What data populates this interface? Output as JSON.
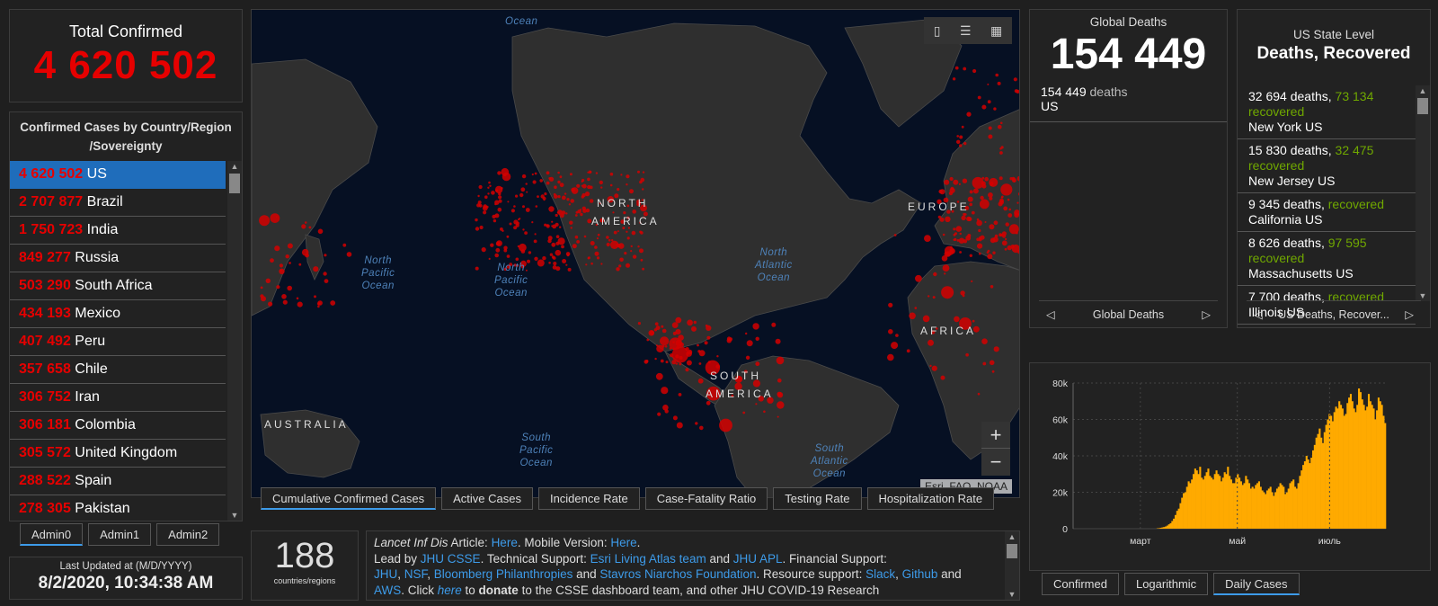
{
  "total": {
    "label": "Total Confirmed",
    "value": "4 620 502"
  },
  "countries": {
    "header": "Confirmed Cases by Country/Region/Sovereignty",
    "items": [
      {
        "num": "4 620 502",
        "name": "US"
      },
      {
        "num": "2 707 877",
        "name": "Brazil"
      },
      {
        "num": "1 750 723",
        "name": "India"
      },
      {
        "num": "849 277",
        "name": "Russia"
      },
      {
        "num": "503 290",
        "name": "South Africa"
      },
      {
        "num": "434 193",
        "name": "Mexico"
      },
      {
        "num": "407 492",
        "name": "Peru"
      },
      {
        "num": "357 658",
        "name": "Chile"
      },
      {
        "num": "306 752",
        "name": "Iran"
      },
      {
        "num": "306 181",
        "name": "Colombia"
      },
      {
        "num": "305 572",
        "name": "United Kingdom"
      },
      {
        "num": "288 522",
        "name": "Spain"
      },
      {
        "num": "278 305",
        "name": "Pakistan"
      }
    ]
  },
  "admin_tabs": [
    "Admin0",
    "Admin1",
    "Admin2"
  ],
  "updated": {
    "label": "Last Updated at (M/D/YYYY)",
    "value": "8/2/2020, 10:34:38 AM"
  },
  "map": {
    "labels": {
      "north_america_1": "NORTH",
      "north_america_2": "AMERICA",
      "south_america_1": "SOUTH",
      "south_america_2": "AMERICA",
      "europe": "EUROPE",
      "africa": "AFRICA",
      "australia": "AUSTRALIA",
      "np1_a": "North",
      "np1_b": "Pacific",
      "np1_c": "Ocean",
      "np2_a": "North",
      "np2_b": "Pacific",
      "np2_c": "Ocean",
      "na_a": "North",
      "na_b": "Atlantic",
      "na_c": "Ocean",
      "sp_a": "South",
      "sp_b": "Pacific",
      "sp_c": "Ocean",
      "sa_a": "South",
      "sa_b": "Atlantic",
      "sa_c": "Ocean",
      "arctic": "Ocean"
    },
    "attribution": "Esri, FAO, NOAA",
    "zoom_in": "+",
    "zoom_out": "−"
  },
  "map_tabs": [
    "Cumulative Confirmed Cases",
    "Active Cases",
    "Incidence Rate",
    "Case-Fatality Ratio",
    "Testing Rate",
    "Hospitalization Rate"
  ],
  "counter": {
    "value": "188",
    "label": "countries/regions"
  },
  "info": {
    "a1": "Lancet Inf Dis",
    "a2": " Article: ",
    "a3": "Here",
    "a4": ". Mobile Version: ",
    "a5": "Here",
    "a6": ".",
    "b1": "Lead by ",
    "b2": "JHU CSSE",
    "b3": ". Technical Support: ",
    "b4": "Esri Living Atlas team",
    "b5": " and ",
    "b6": "JHU APL",
    "b7": ". Financial Support:",
    "c1": "JHU",
    "c2": ", ",
    "c3": "NSF",
    "c4": ", ",
    "c5": "Bloomberg Philanthropies",
    "c6": " and ",
    "c7": "Stavros Niarchos Foundation",
    "c8": ". Resource support: ",
    "c9": "Slack",
    "c10": ", ",
    "c11": "Github",
    "c12": " and",
    "d1": "AWS",
    "d2": ". Click ",
    "d3": "here",
    "d4": " to ",
    "d5": "donate",
    "d6": " to the CSSE dashboard team, and other JHU COVID-19 Research"
  },
  "global_deaths": {
    "label": "Global Deaths",
    "value": "154 449",
    "row_num": "154 449",
    "row_unit": "deaths",
    "row_place": "US",
    "pager": "Global Deaths"
  },
  "us_state": {
    "label": "US State Level",
    "title": "Deaths, Recovered",
    "items": [
      {
        "deaths": "32 694 deaths,",
        "rec": "73 134",
        "rec_lbl": "recovered",
        "state": "New York US"
      },
      {
        "deaths": "15 830 deaths,",
        "rec": "32 475",
        "rec_lbl": "recovered",
        "state": "New Jersey US"
      },
      {
        "deaths": "9 345 deaths,",
        "rec": "",
        "rec_lbl": "recovered",
        "state": "California US"
      },
      {
        "deaths": "8 626 deaths,",
        "rec": "97 595",
        "rec_lbl": "recovered",
        "state": "Massachusetts US"
      },
      {
        "deaths": "7 700 deaths,",
        "rec": "",
        "rec_lbl": "recovered",
        "state": "Illinois US"
      }
    ],
    "pager": "US Deaths, Recover..."
  },
  "chart_tabs": [
    "Confirmed",
    "Logarithmic",
    "Daily Cases"
  ],
  "colors": {
    "accent": "#3d9be9",
    "confirmed": "#e60000",
    "recovered": "#70a800",
    "bars": "#ffaa00"
  },
  "chart_data": {
    "type": "bar",
    "title": "",
    "xlabel": "",
    "ylabel": "",
    "ylim": [
      0,
      80000
    ],
    "y_ticks": [
      "0",
      "20k",
      "40k",
      "60k",
      "80k"
    ],
    "x_ticks": [
      "март",
      "май",
      "июль"
    ],
    "series": [
      {
        "values": [
          0,
          0,
          0,
          0,
          0,
          0,
          0,
          0,
          0,
          0,
          0,
          0,
          0,
          0,
          0,
          0,
          0,
          0,
          0,
          0,
          0,
          0,
          0,
          0,
          0,
          0,
          0,
          0,
          0,
          0,
          0,
          0,
          0,
          0,
          0,
          0,
          0,
          0,
          0,
          0,
          0,
          0,
          0,
          0,
          0,
          0,
          0,
          0,
          0,
          0,
          0,
          200,
          300,
          500,
          700,
          900,
          1200,
          1700,
          2400,
          3000,
          4200,
          5500,
          7500,
          9800,
          11000,
          14000,
          17000,
          19500,
          20000,
          23000,
          26000,
          25000,
          27000,
          30000,
          33000,
          32000,
          30000,
          34000,
          28000,
          27000,
          29000,
          31000,
          33000,
          29000,
          28000,
          27000,
          30000,
          32000,
          30000,
          29000,
          26000,
          28000,
          31000,
          30000,
          34000,
          29000,
          27000,
          25000,
          25000,
          28000,
          30000,
          28000,
          26000,
          24000,
          25000,
          29000,
          27000,
          25000,
          22000,
          23000,
          22000,
          24000,
          25000,
          26000,
          23000,
          21000,
          20000,
          19000,
          21000,
          22000,
          23000,
          20000,
          18000,
          20000,
          22000,
          23000,
          25000,
          24000,
          23000,
          19000,
          20000,
          22000,
          25000,
          26000,
          27000,
          23000,
          22000,
          25000,
          29000,
          32000,
          35000,
          37000,
          40000,
          38000,
          36000,
          39000,
          43000,
          46000,
          50000,
          52000,
          55000,
          50000,
          47000,
          53000,
          57000,
          60000,
          63000,
          62000,
          59000,
          64000,
          67000,
          66000,
          70000,
          68000,
          66000,
          62000,
          63000,
          69000,
          72000,
          74000,
          70000,
          66000,
          64000,
          68000,
          77000,
          75000,
          71000,
          68000,
          65000,
          67000,
          74000,
          70000,
          68000,
          66000,
          60000,
          65000,
          72000,
          70000,
          68000,
          62000,
          58000
        ]
      }
    ]
  }
}
